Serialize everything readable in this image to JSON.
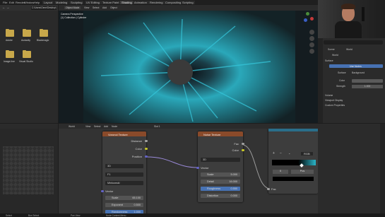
{
  "topbar": {
    "menus": [
      "File",
      "Edit",
      "Render",
      "Window",
      "Help"
    ],
    "tabs": [
      "Layout",
      "Modeling",
      "Sculpting",
      "UV Editing",
      "Texture Paint",
      "Shading",
      "Animation",
      "Rendering",
      "Compositing",
      "Scripting"
    ],
    "active_tab": "Shading"
  },
  "file_browser": {
    "path": "C:\\Users\\Gene\\Desktop\\",
    "folders": [
      {
        "label": "Adobe"
      },
      {
        "label": "Audacity"
      },
      {
        "label": "Blackmagic"
      },
      {
        "label": "Image-line"
      },
      {
        "label": "Visual Studio"
      }
    ]
  },
  "viewport": {
    "header_items": [
      "Object Mode",
      "View",
      "Select",
      "Add",
      "Object"
    ],
    "perspective_text": "Camera Perspective",
    "object_text": "(1) Collection | Cylinder"
  },
  "properties": {
    "tabs": [
      "Scene",
      "World"
    ],
    "world_name": "World",
    "surface_label": "Surface",
    "surface_value": "Background",
    "use_nodes": "Use Nodes",
    "color_label": "Color",
    "strength_label": "Strength",
    "strength_value": "1.000",
    "panels": [
      "Volume",
      "Viewport Display",
      "Custom Properties"
    ]
  },
  "node_header": {
    "items": [
      "World",
      "View",
      "Select",
      "Add",
      "Node"
    ],
    "slot": "Slot 1"
  },
  "voronoi_node": {
    "title": "Voronoi Texture",
    "outputs": [
      "Distance",
      "Color",
      "Position"
    ],
    "dims": "3D",
    "feature": "F1",
    "metric": "Minkowski",
    "vector": "Vector",
    "scale_label": "Scale",
    "scale_value": "65.100",
    "exponent_label": "Exponent",
    "exponent_value": "0.500",
    "randomness_label": "Randomness",
    "randomness_value": "1.000"
  },
  "noise_node": {
    "title": "Noise Texture",
    "outputs": [
      "Fac",
      "Color"
    ],
    "dims": "3D",
    "vector": "Vector",
    "scale_label": "Scale",
    "scale_value": "5.000",
    "detail_label": "Detail",
    "detail_value": "16.000",
    "roughness_label": "Roughness",
    "roughness_value": "0.550",
    "distortion_label": "Distortion",
    "distortion_value": "0.000"
  },
  "color_ramp": {
    "mode": "RGB",
    "pos_label": "0",
    "pos_value": "Pos",
    "fac": "Fac"
  },
  "status": {
    "left": "Select",
    "mid": "Box Select",
    "right": "Pan View",
    "info": "Node Context Menu"
  },
  "colors": {
    "accent": "#4772b3",
    "node_header": "#8a4a2a",
    "texture_cyan": "#2bb5c8",
    "folder": "#c8a84a"
  }
}
